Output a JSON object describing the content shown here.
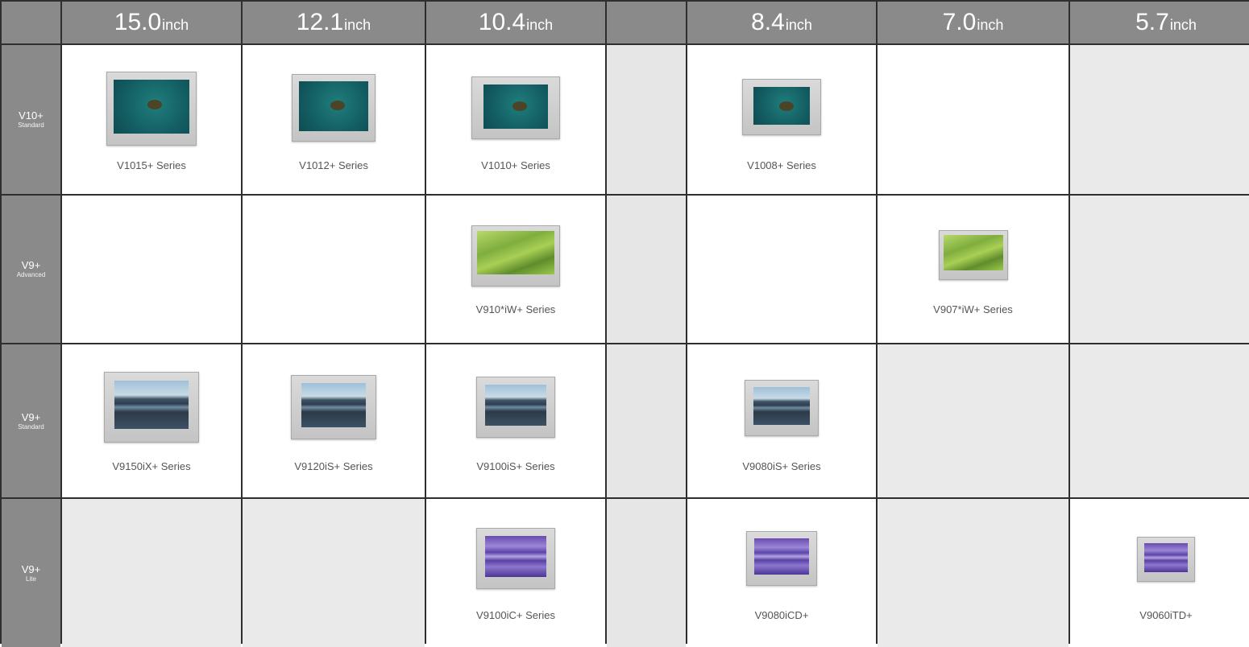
{
  "columns": [
    {
      "size": "15.0",
      "unit": "inch"
    },
    {
      "size": "12.1",
      "unit": "inch"
    },
    {
      "size": "10.4",
      "unit": "inch"
    },
    {
      "size": "",
      "unit": ""
    },
    {
      "size": "8.4",
      "unit": "inch"
    },
    {
      "size": "7.0",
      "unit": "inch"
    },
    {
      "size": "5.7",
      "unit": "inch"
    }
  ],
  "rows": [
    {
      "name": "V10+",
      "tier": "Standard"
    },
    {
      "name": "V9+",
      "tier": "Advanced"
    },
    {
      "name": "V9+",
      "tier": "Standard"
    },
    {
      "name": "V9+",
      "tier": "Lite"
    }
  ],
  "products": {
    "v10_15": "V1015+ Series",
    "v10_12": "V1012+ Series",
    "v10_10": "V1010+ Series",
    "v10_08": "V1008+ Series",
    "adv_10": "V910*iW+ Series",
    "adv_07": "V907*iW+ Series",
    "std_15": "V9150iX+ Series",
    "std_12": "V9120iS+ Series",
    "std_10": "V9100iS+ Series",
    "std_08": "V9080iS+ Series",
    "lite_10": "V9100iC+ Series",
    "lite_08": "V9080iCD+",
    "lite_06": "V9060iTD+"
  },
  "screen_themes": {
    "v10": "teal-lake",
    "advanced": "green-leaf",
    "standard": "mountain-lake",
    "lite": "purple-sky"
  }
}
